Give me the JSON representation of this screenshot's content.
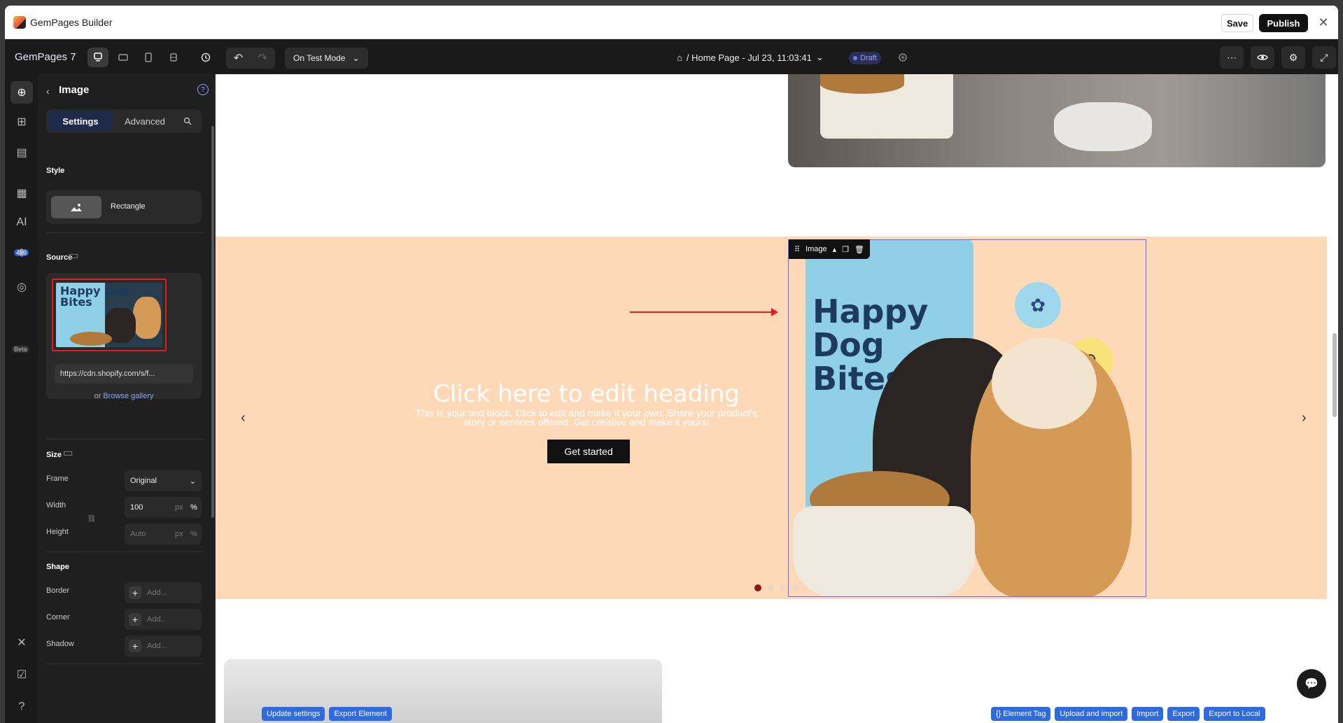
{
  "app": {
    "title": "GemPages Builder",
    "save_label": "Save",
    "publish_label": "Publish",
    "close_glyph": "✕"
  },
  "toolbar": {
    "brand": "GemPages 7",
    "mode": "On Test Mode",
    "page": "/ Home Page - Jul 23, 11:03:41",
    "status": "Draft",
    "icons": {
      "desktop": "desktop-icon",
      "tablet_h": "tablet-landscape-icon",
      "tablet": "tablet-icon",
      "mobile": "mobile-icon",
      "history": "history-icon",
      "undo": "undo-icon",
      "redo": "redo-icon",
      "home": "home-icon",
      "more": "more-icon",
      "preview": "eye-icon",
      "settings": "gear-icon",
      "expand": "expand-icon"
    }
  },
  "rail": {
    "badge_count": "450",
    "beta": "Beta"
  },
  "panel": {
    "title": "Image",
    "tabs": {
      "settings": "Settings",
      "advanced": "Advanced"
    },
    "style": {
      "label": "Style",
      "option": "Rectangle"
    },
    "source": {
      "label": "Source",
      "url": "https://cdn.shopify.com/s/f...",
      "or": "or",
      "gallery": "Browse gallery",
      "thumb_text": "Happy Dog Bites"
    },
    "size": {
      "label": "Size",
      "frame_label": "Frame",
      "frame_value": "Original",
      "width_label": "Width",
      "width_value": "100",
      "width_unit_px": "px",
      "width_unit_pct": "%",
      "height_label": "Height",
      "height_placeholder": "Auto",
      "height_unit_px": "px",
      "height_unit_pct": "%"
    },
    "shape": {
      "label": "Shape",
      "border_label": "Border",
      "corner_label": "Corner",
      "shadow_label": "Shadow",
      "add_placeholder": "Add..."
    }
  },
  "canvas": {
    "hero": {
      "heading": "Click here to edit heading",
      "text": "This is your text block. Click to edit and make it your own. Share your product's story or services offered. Get creative and make it yours!",
      "button": "Get started"
    },
    "image_toolbar": {
      "label": "Image"
    },
    "product": {
      "bag_text_1": "Happy",
      "bag_text_2": "Dog",
      "bag_text_3": "Bites"
    },
    "carousel": {
      "active_index": 0,
      "count": 4
    }
  },
  "dev_buttons": {
    "left": [
      "Update settings",
      "Export Element"
    ],
    "right": [
      "{} Element Tag",
      "Upload and import",
      "Import",
      "Export",
      "Export to Local"
    ]
  },
  "colors": {
    "accent": "#2f6bdf",
    "hero_bg": "#fdd9b8",
    "selection": "#5a6bff"
  }
}
